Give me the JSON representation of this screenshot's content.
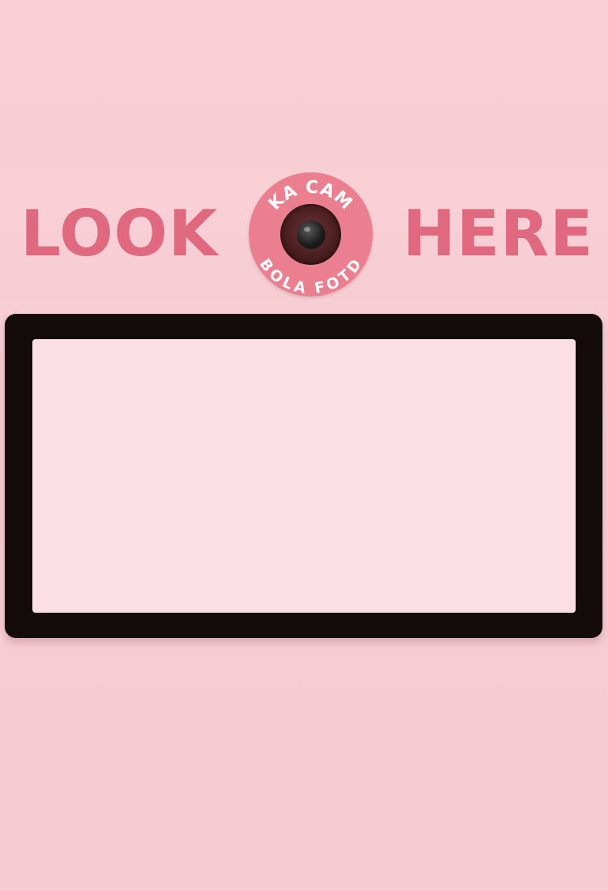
{
  "banner": {
    "left_text": "LOOK",
    "right_text": "HERE",
    "text_color": "#e1697f",
    "background_color": "#f8d1d7"
  },
  "camera_badge": {
    "top_text": "KA CAM",
    "bottom_text": "BOLA FOTD",
    "badge_color": "#ec7f8f",
    "text_color": "#ffffff",
    "icon": "camera-lens-icon"
  },
  "screen": {
    "frame_color": "#140c0b",
    "display_color": "#fcdfe4"
  },
  "page": {
    "background_color": "#f6cdd3"
  }
}
